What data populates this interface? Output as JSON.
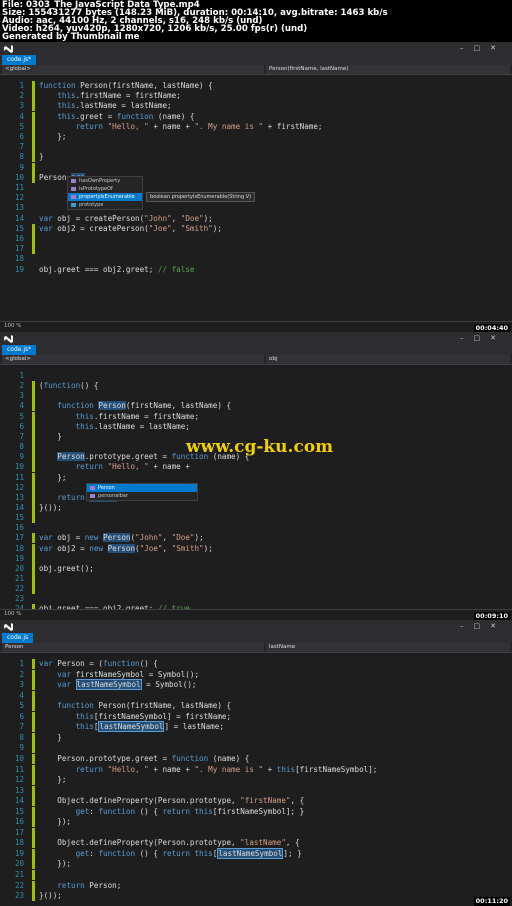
{
  "header": {
    "lines": [
      "File: 0303_The JavaScript Data Type.mp4",
      "Size: 155431277 bytes (148.23 MiB), duration: 00:14:10, avg.bitrate: 1463 kb/s",
      "Audio: aac, 44100 Hz, 2 channels, s16, 248 kb/s (und)",
      "Video: h264, yuv420p, 1280x720, 1206 kb/s, 25.00 fps(r) (und)",
      "Generated by Thumbnail me"
    ]
  },
  "panels": [
    {
      "title": "",
      "tab": "code.js*",
      "nav_left": "<global>",
      "nav_right": "Person(firstName, lastName)",
      "zoom": "100 %",
      "timestamp": "00:04:40",
      "lines": [
        {
          "n": "1",
          "g": true,
          "h": "function Person(firstName, lastName) {"
        },
        {
          "n": "2",
          "g": true,
          "h": "    this.firstName = firstName;"
        },
        {
          "n": "3",
          "g": true,
          "h": "    this.lastName = lastName;"
        },
        {
          "n": "4",
          "g": true,
          "h": "    this.greet = function (name) {"
        },
        {
          "n": "5",
          "g": true,
          "h": "        return \"Hello, \" + name + \". My name is \" + firstName;"
        },
        {
          "n": "6",
          "g": true,
          "h": "    };"
        },
        {
          "n": "7",
          "g": true,
          "h": ""
        },
        {
          "n": "8",
          "g": true,
          "h": "}"
        },
        {
          "n": "9",
          "g": true,
          "h": ""
        },
        {
          "n": "10",
          "g": true,
          "h": "Person.pro"
        },
        {
          "n": "11",
          "g": false,
          "h": ""
        },
        {
          "n": "12",
          "g": false,
          "h": ""
        },
        {
          "n": "13",
          "g": false,
          "h": ""
        },
        {
          "n": "14",
          "g": false,
          "h": "var obj = createPerson(\"John\", \"Doe\");"
        },
        {
          "n": "15",
          "g": true,
          "h": "var obj2 = createPerson(\"Joe\", \"Smith\");"
        },
        {
          "n": "16",
          "g": true,
          "h": ""
        },
        {
          "n": "17",
          "g": true,
          "h": ""
        },
        {
          "n": "18",
          "g": false,
          "h": ""
        },
        {
          "n": "19",
          "g": false,
          "h": "obj.greet === obj2.greet; // false"
        }
      ],
      "intellisense": {
        "items": [
          "hasOwnProperty",
          "isPrototypeOf",
          "propertyIsEnumerable",
          "prototype"
        ],
        "selected": 2,
        "tooltip": "boolean propertyIsEnumerable(String V)"
      }
    },
    {
      "title": "",
      "tab": "code.js*",
      "nav_left": "<global>",
      "nav_right": "obj",
      "zoom": "100 %",
      "timestamp": "00:09:10",
      "lines": [
        {
          "n": "1",
          "g": false,
          "h": ""
        },
        {
          "n": "2",
          "g": true,
          "h": "(function() {"
        },
        {
          "n": "3",
          "g": true,
          "h": ""
        },
        {
          "n": "4",
          "g": true,
          "h": "    function Person(firstName, lastName) {"
        },
        {
          "n": "5",
          "g": true,
          "h": "        this.firstName = firstName;"
        },
        {
          "n": "6",
          "g": true,
          "h": "        this.lastName = lastName;"
        },
        {
          "n": "7",
          "g": true,
          "h": "    }"
        },
        {
          "n": "8",
          "g": true,
          "h": ""
        },
        {
          "n": "9",
          "g": true,
          "h": "    Person.prototype.greet = function (name) {"
        },
        {
          "n": "10",
          "g": true,
          "h": "        return \"Hello, \" + name +"
        },
        {
          "n": "11",
          "g": true,
          "h": "    };"
        },
        {
          "n": "12",
          "g": true,
          "h": ""
        },
        {
          "n": "13",
          "g": true,
          "h": "    return Person"
        },
        {
          "n": "14",
          "g": true,
          "h": "}());"
        },
        {
          "n": "15",
          "g": true,
          "h": ""
        },
        {
          "n": "16",
          "g": false,
          "h": ""
        },
        {
          "n": "17",
          "g": true,
          "h": "var obj = new Person(\"John\", \"Doe\");"
        },
        {
          "n": "18",
          "g": true,
          "h": "var obj2 = new Person(\"Joe\", \"Smith\");"
        },
        {
          "n": "19",
          "g": true,
          "h": ""
        },
        {
          "n": "20",
          "g": true,
          "h": "obj.greet();"
        },
        {
          "n": "21",
          "g": true,
          "h": ""
        },
        {
          "n": "22",
          "g": true,
          "h": ""
        },
        {
          "n": "23",
          "g": false,
          "h": ""
        },
        {
          "n": "24",
          "g": true,
          "h": "obj.greet === obj2.greet; // true"
        }
      ],
      "intellisense": {
        "items": [
          "Person",
          "personalbar"
        ],
        "selected": 0,
        "tooltip": ""
      },
      "watermark": "www.cg-ku.com"
    },
    {
      "title": "",
      "tab": "code.js",
      "nav_left": "Person",
      "nav_right": "lastName",
      "zoom": "100 %",
      "timestamp": "00:11:20",
      "lines": [
        {
          "n": "1",
          "g": true,
          "h": "var Person = (function() {"
        },
        {
          "n": "2",
          "g": true,
          "h": "    var firstNameSymbol = Symbol();"
        },
        {
          "n": "3",
          "g": true,
          "h": "    var lastNameSymbol = Symbol();"
        },
        {
          "n": "4",
          "g": true,
          "h": ""
        },
        {
          "n": "5",
          "g": true,
          "h": "    function Person(firstName, lastName) {"
        },
        {
          "n": "6",
          "g": true,
          "h": "        this[firstNameSymbol] = firstName;"
        },
        {
          "n": "7",
          "g": true,
          "h": "        this[lastNameSymbol] = lastName;"
        },
        {
          "n": "8",
          "g": true,
          "h": "    }"
        },
        {
          "n": "9",
          "g": true,
          "h": ""
        },
        {
          "n": "10",
          "g": true,
          "h": "    Person.prototype.greet = function (name) {"
        },
        {
          "n": "11",
          "g": true,
          "h": "        return \"Hello, \" + name + \". My name is \" + this[firstNameSymbol];"
        },
        {
          "n": "12",
          "g": true,
          "h": "    };"
        },
        {
          "n": "13",
          "g": true,
          "h": ""
        },
        {
          "n": "14",
          "g": true,
          "h": "    Object.defineProperty(Person.prototype, \"firstName\", {"
        },
        {
          "n": "15",
          "g": true,
          "h": "        get: function () { return this[firstNameSymbol]; }"
        },
        {
          "n": "16",
          "g": true,
          "h": "    });"
        },
        {
          "n": "17",
          "g": true,
          "h": ""
        },
        {
          "n": "18",
          "g": true,
          "h": "    Object.defineProperty(Person.prototype, \"lastName\", {"
        },
        {
          "n": "19",
          "g": true,
          "h": "        get: function () { return this[lastNameSymbol]; }"
        },
        {
          "n": "20",
          "g": true,
          "h": "    });"
        },
        {
          "n": "21",
          "g": true,
          "h": ""
        },
        {
          "n": "22",
          "g": true,
          "h": "    return Person;"
        },
        {
          "n": "23",
          "g": true,
          "h": "}());"
        }
      ]
    }
  ]
}
